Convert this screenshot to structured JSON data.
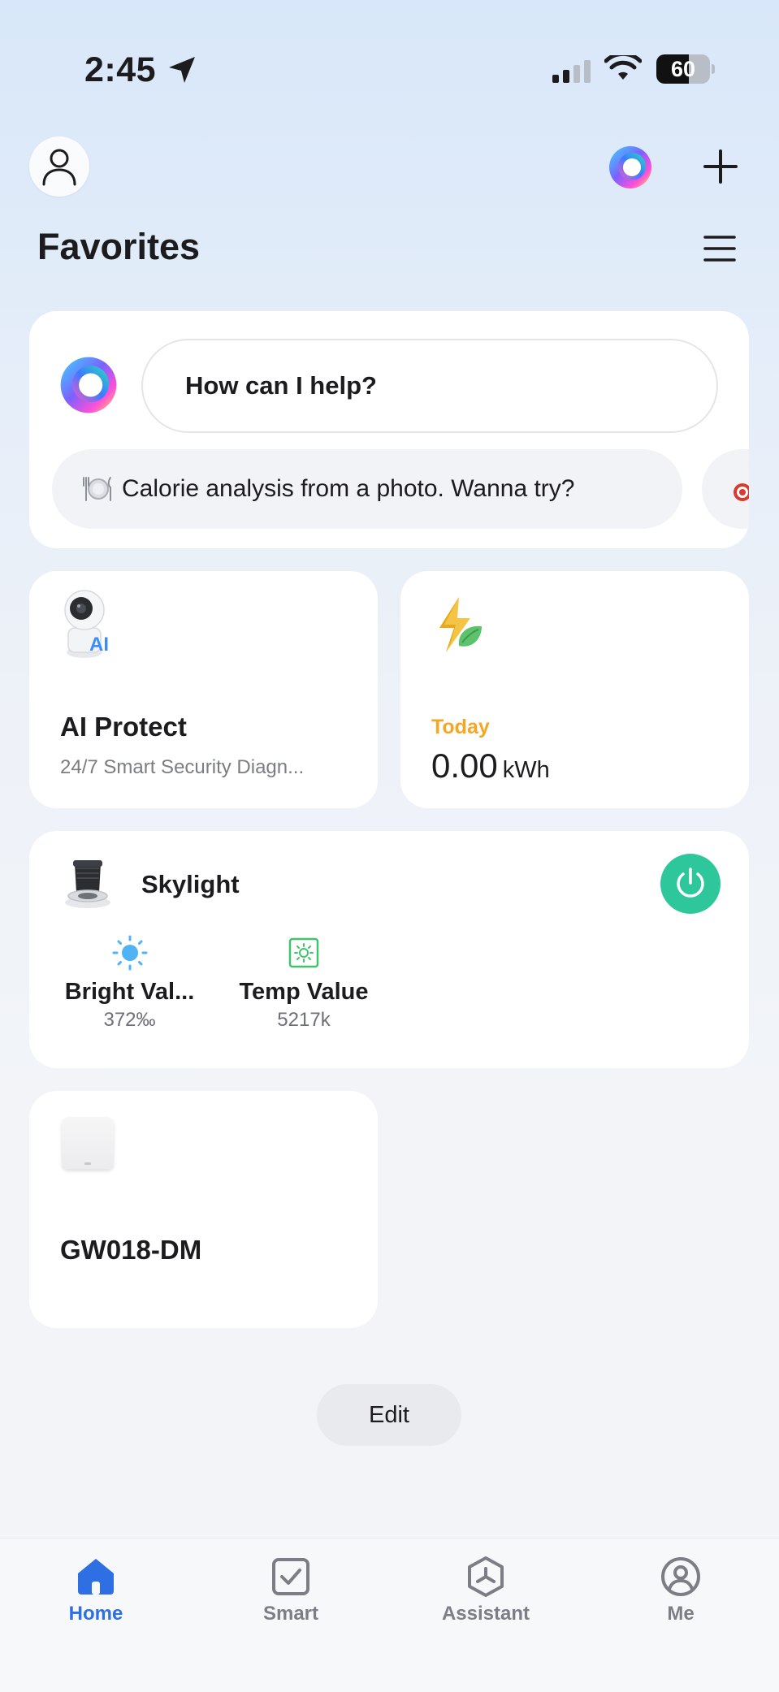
{
  "status_bar": {
    "time": "2:45",
    "battery_percent": 60,
    "battery_text": "60"
  },
  "header": {
    "title": "Favorites"
  },
  "assistant": {
    "placeholder": "How can I help?",
    "suggestion": "Calorie analysis from a photo. Wanna try?"
  },
  "ai_protect": {
    "title": "AI Protect",
    "subtitle": "24/7 Smart Security Diagn..."
  },
  "energy": {
    "label": "Today",
    "value": "0.00",
    "unit": "kWh"
  },
  "skylight": {
    "name": "Skylight",
    "power_on": true,
    "brightness_label": "Bright Val...",
    "brightness_value": "372‰",
    "temp_label": "Temp Value",
    "temp_value": "5217k"
  },
  "gateway": {
    "name": "GW018-DM"
  },
  "edit_label": "Edit",
  "tabs": [
    {
      "label": "Home",
      "icon": "home-icon",
      "active": true
    },
    {
      "label": "Smart",
      "icon": "smart-check-icon",
      "active": false
    },
    {
      "label": "Assistant",
      "icon": "assistant-icon",
      "active": false
    },
    {
      "label": "Me",
      "icon": "profile-icon",
      "active": false
    }
  ],
  "colors": {
    "accent": "#2f6fe4",
    "power_on": "#2ec79b",
    "today_label": "#f5a623"
  }
}
